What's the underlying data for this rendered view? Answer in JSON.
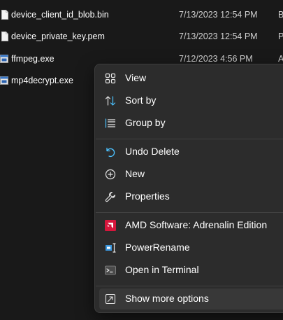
{
  "files": [
    {
      "name": "device_client_id_blob.bin",
      "date": "7/13/2023 12:54 PM",
      "type": "B",
      "icon": "file-icon"
    },
    {
      "name": "device_private_key.pem",
      "date": "7/13/2023 12:54 PM",
      "type": "P",
      "icon": "file-icon"
    },
    {
      "name": "ffmpeg.exe",
      "date": "7/12/2023 4:56 PM",
      "type": "A",
      "icon": "exe-icon"
    },
    {
      "name": "mp4decrypt.exe",
      "date": "",
      "type": "",
      "icon": "exe-icon"
    }
  ],
  "menu": {
    "view": "View",
    "sort_by": "Sort by",
    "group_by": "Group by",
    "undo_delete": "Undo Delete",
    "new": "New",
    "properties": "Properties",
    "amd": "AMD Software: Adrenalin Edition",
    "power_rename": "PowerRename",
    "open_terminal": "Open in Terminal",
    "show_more": "Show more options"
  },
  "colors": {
    "background": "#191919",
    "menu_bg": "#2c2c2c",
    "accent_blue": "#4cc2ff",
    "amd_red": "#d6163c"
  }
}
